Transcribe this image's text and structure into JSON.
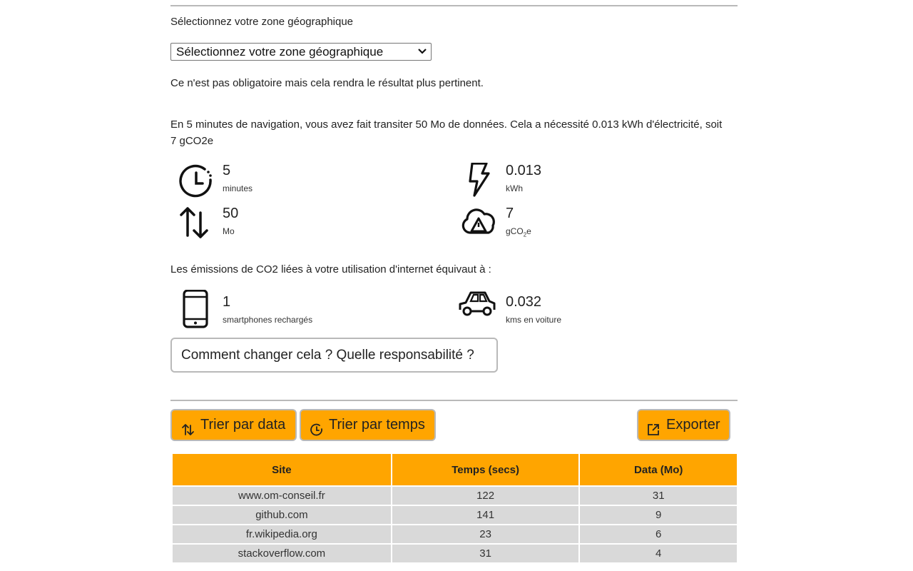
{
  "zone": {
    "label": "Sélectionnez votre zone géographique",
    "select_value": "Sélectionnez votre zone géographique",
    "note": "Ce n'est pas obligatoire mais cela rendra le résultat plus pertinent."
  },
  "summary": "En 5 minutes de navigation, vous avez fait transiter 50 Mo de données. Cela a nécessité 0.013 kWh d'électricité, soit 7 gCO2e",
  "stats": {
    "time": {
      "value": "5",
      "unit": "minutes",
      "icon": "clock-icon"
    },
    "energy": {
      "value": "0.013",
      "unit": "kWh",
      "icon": "lightning-icon"
    },
    "data": {
      "value": "50",
      "unit": "Mo",
      "icon": "transfer-arrows-icon"
    },
    "co2": {
      "value": "7",
      "unit_prefix": "gCO",
      "unit_sub": "2",
      "unit_suffix": "e",
      "icon": "cloud-warning-icon"
    }
  },
  "equivalence": {
    "heading": "Les émissions de CO2 liées à votre utilisation d'internet équivaut à :",
    "smartphones": {
      "value": "1",
      "unit": "smartphones rechargés",
      "icon": "smartphone-icon"
    },
    "car": {
      "value": "0.032",
      "unit": "kms en voiture",
      "icon": "car-icon"
    }
  },
  "change_button": "Comment changer cela ? Quelle responsabilité ?",
  "toolbar": {
    "sort_data": "Trier par data",
    "sort_time": "Trier par temps",
    "export": "Exporter"
  },
  "colors": {
    "accent": "#ffa500",
    "row_bg": "#d9d9d9",
    "divider": "#b9b9b9"
  },
  "table": {
    "headers": [
      "Site",
      "Temps (secs)",
      "Data (Mo)"
    ],
    "rows": [
      [
        "www.om-conseil.fr",
        "122",
        "31"
      ],
      [
        "github.com",
        "141",
        "9"
      ],
      [
        "fr.wikipedia.org",
        "23",
        "6"
      ],
      [
        "stackoverflow.com",
        "31",
        "4"
      ]
    ]
  }
}
